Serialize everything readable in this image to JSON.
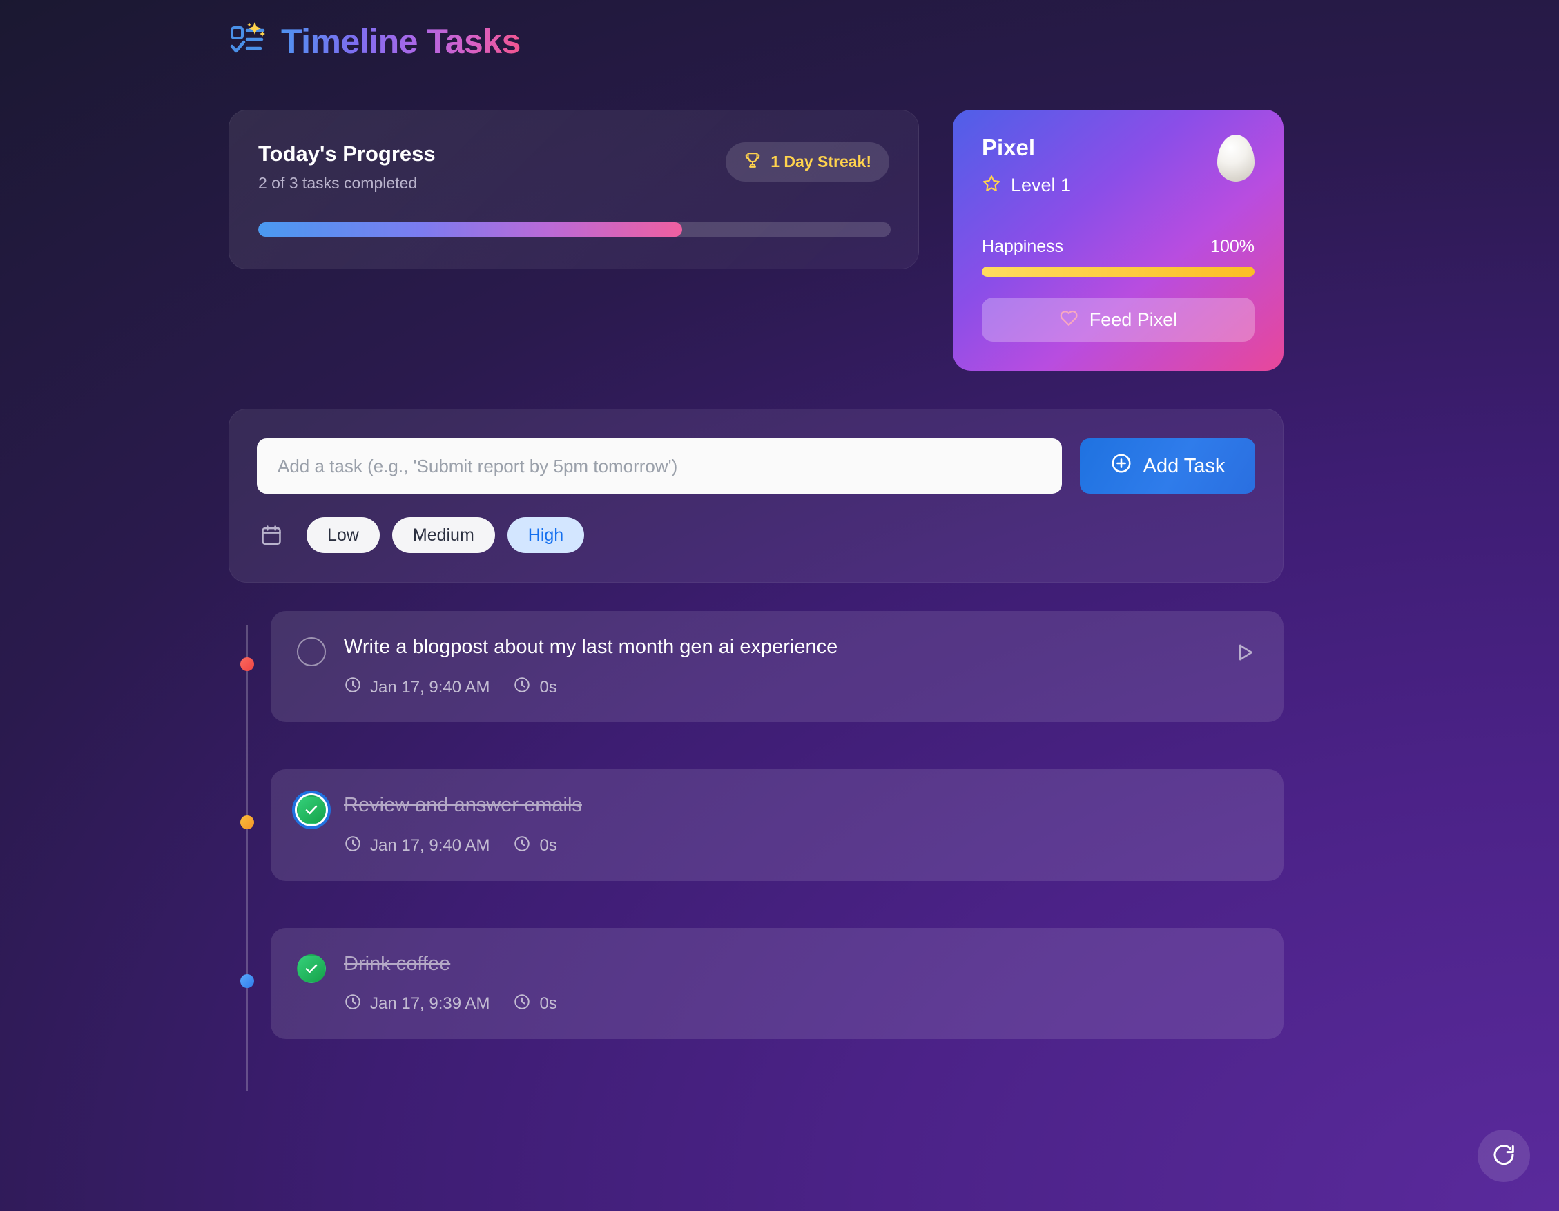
{
  "app": {
    "title": "Timeline Tasks",
    "logo_icon": "list-check-sparkle-icon"
  },
  "progress": {
    "title": "Today's Progress",
    "subtitle": "2 of 3 tasks completed",
    "completed": 2,
    "total": 3,
    "percent": 67,
    "streak": {
      "icon": "trophy-icon",
      "label": "1 Day Streak!",
      "color": "#ffd34d"
    }
  },
  "pixel": {
    "name": "Pixel",
    "level_icon": "star-icon",
    "level_label": "Level 1",
    "avatar_icon": "egg-icon",
    "happiness_label": "Happiness",
    "happiness_value": "100%",
    "happiness_percent": 100,
    "feed_button": {
      "icon": "heart-icon",
      "label": "Feed Pixel"
    },
    "gradient_start": "#4f5fe8",
    "gradient_end": "#e8479a"
  },
  "composer": {
    "input_value": "",
    "input_placeholder": "Add a task (e.g., 'Submit report by 5pm tomorrow')",
    "add_button": {
      "icon": "plus-circle-icon",
      "label": "Add Task"
    },
    "calendar_icon": "calendar-icon",
    "priorities": [
      {
        "label": "Low",
        "selected": false
      },
      {
        "label": "Medium",
        "selected": false
      },
      {
        "label": "High",
        "selected": true
      }
    ]
  },
  "timeline": {
    "tasks": [
      {
        "title": "Write a blogpost about my last month gen ai experience",
        "completed": false,
        "priority": "high",
        "dot_color": "#ef4444",
        "date": "Jan 17, 9:40 AM",
        "duration": "0s",
        "date_icon": "clock-icon",
        "duration_icon": "clock-icon",
        "action_icon": "play-icon",
        "has_action": true,
        "focused": false
      },
      {
        "title": "Review and answer emails",
        "completed": true,
        "priority": "medium",
        "dot_color": "#f59427",
        "date": "Jan 17, 9:40 AM",
        "duration": "0s",
        "date_icon": "clock-icon",
        "duration_icon": "clock-icon",
        "action_icon": "",
        "has_action": false,
        "focused": true
      },
      {
        "title": "Drink coffee",
        "completed": true,
        "priority": "low",
        "dot_color": "#2f7ceb",
        "date": "Jan 17, 9:39 AM",
        "duration": "0s",
        "date_icon": "clock-icon",
        "duration_icon": "clock-icon",
        "action_icon": "",
        "has_action": false,
        "focused": false
      }
    ]
  },
  "refresh": {
    "icon": "refresh-icon"
  }
}
